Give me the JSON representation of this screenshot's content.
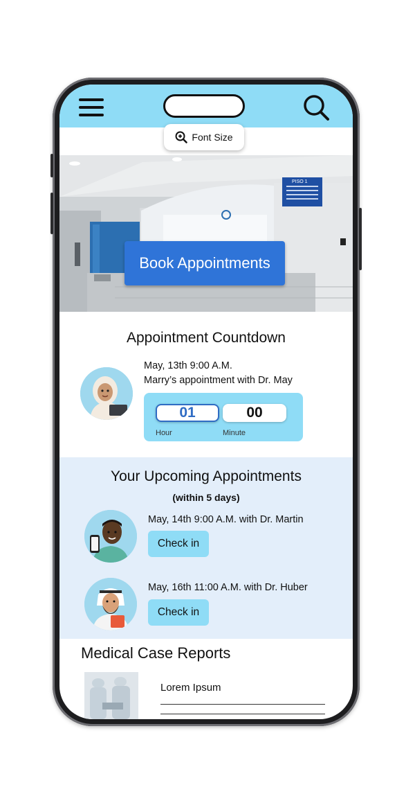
{
  "header": {
    "font_size_label": "Font Size"
  },
  "hero": {
    "book_label": "Book Appointments",
    "sign_text": "PISO 1"
  },
  "countdown": {
    "title": "Appointment Countdown",
    "date": "May, 13th 9:00 A.M.",
    "description": "Marry’s appointment with Dr. May",
    "hours_value": "01",
    "minutes_value": "00",
    "hour_label": "Hour",
    "minute_label": "Minute"
  },
  "upcoming": {
    "title": "Your Upcoming Appointments",
    "subtitle": "(within 5 days)",
    "items": [
      {
        "text": "May, 14th 9:00 A.M. with Dr. Martin",
        "button": "Check in",
        "avatar": "doctor-avatar"
      },
      {
        "text": "May, 16th 11:00 A.M. with Dr. Huber",
        "button": "Check in",
        "avatar": "doctor-avatar"
      }
    ]
  },
  "reports": {
    "title": "Medical Case Reports",
    "items": [
      {
        "text": "Lorem Ipsum"
      }
    ]
  },
  "colors": {
    "accent_light_blue": "#8fdcf6",
    "primary_blue": "#2f74d8",
    "section_bg": "#e3eefa"
  },
  "icons": [
    "menu-icon",
    "search-icon",
    "zoom-icon"
  ]
}
